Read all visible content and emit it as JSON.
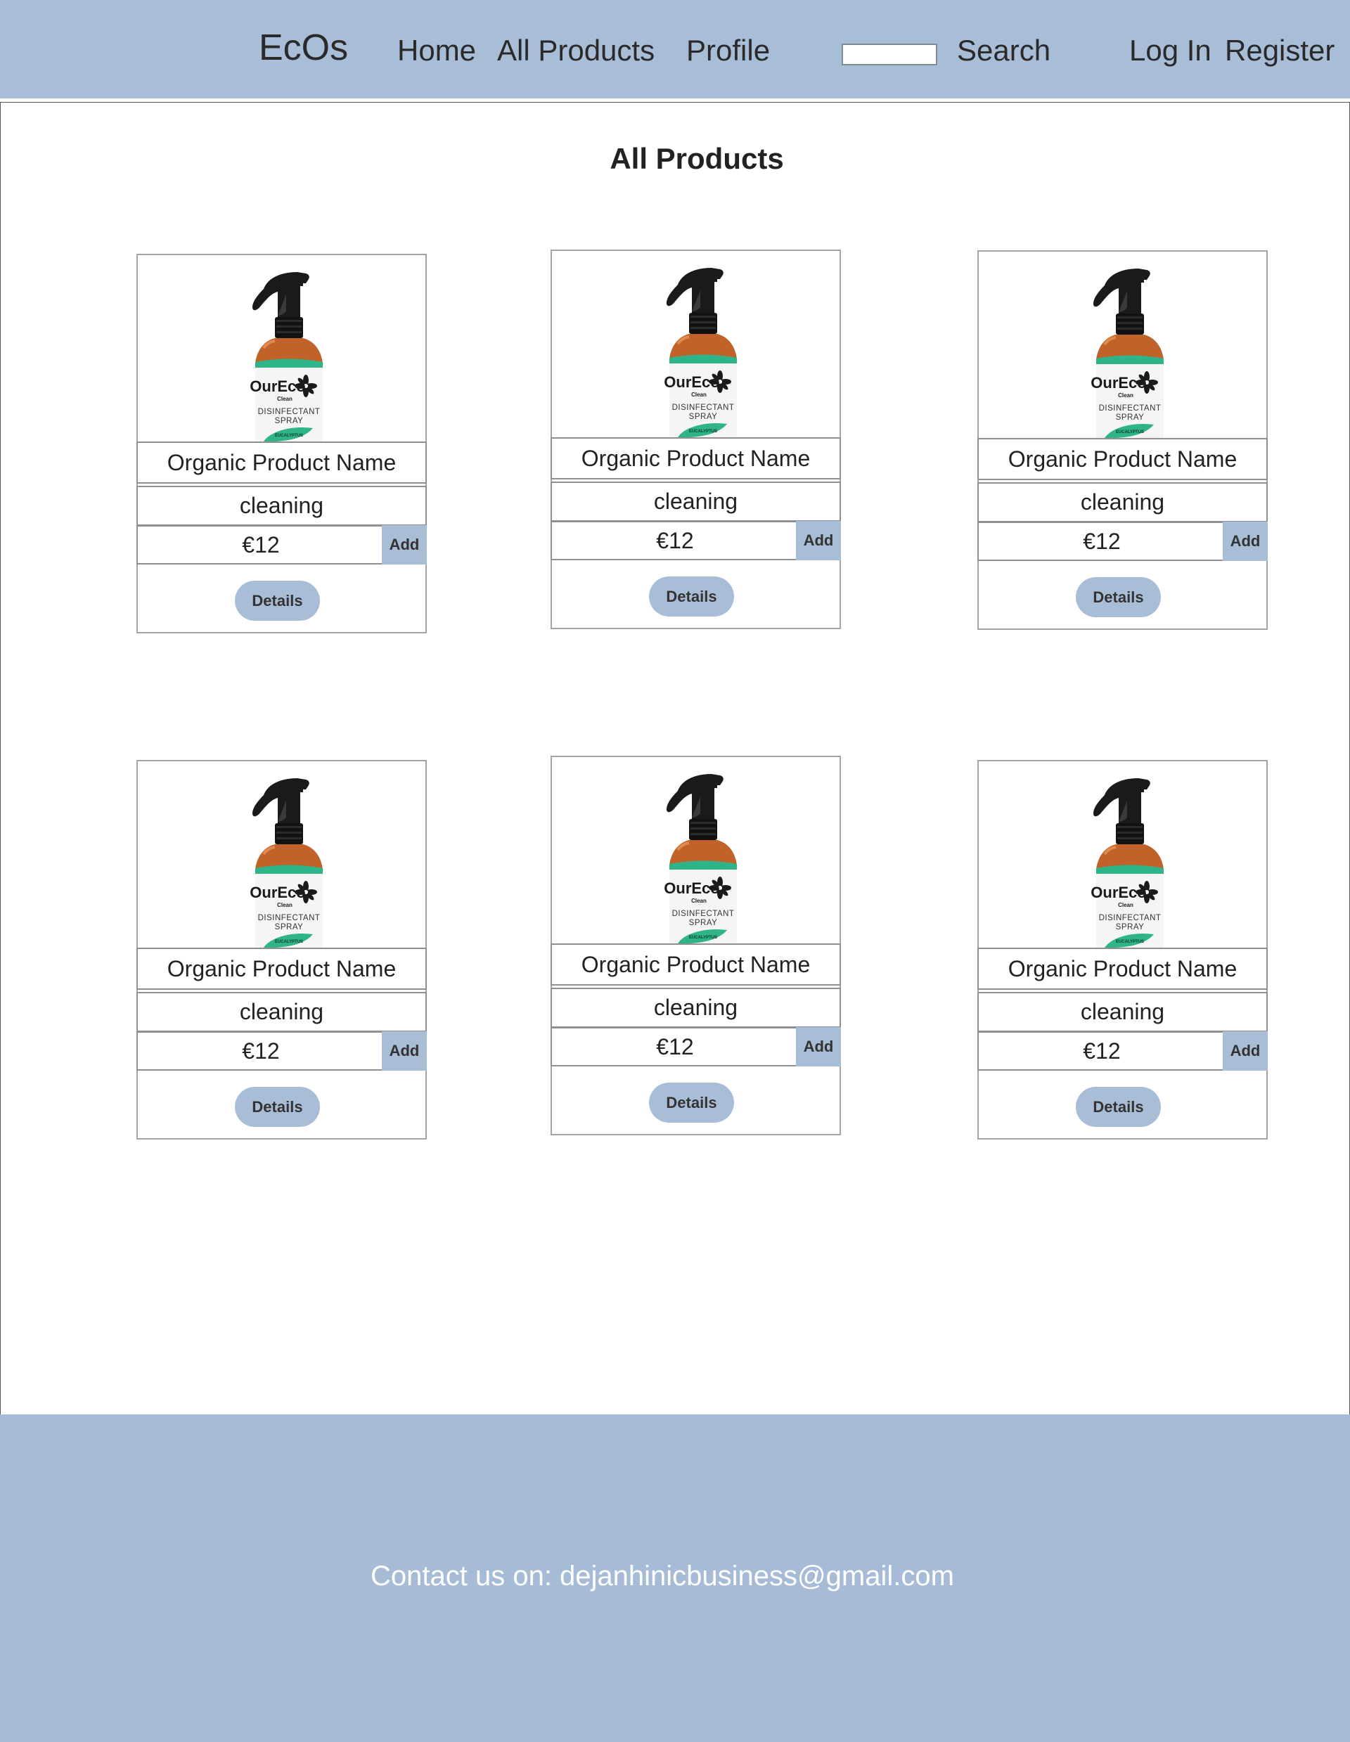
{
  "header": {
    "logo": "EcOs",
    "nav": {
      "home": "Home",
      "all_products": "All Products",
      "profile": "Profile"
    },
    "search": {
      "value": "",
      "placeholder": "",
      "button_label": "Search"
    },
    "auth": {
      "login": "Log In",
      "register": "Register"
    }
  },
  "main": {
    "title": "All Products",
    "products": [
      {
        "name": "Organic Product Name",
        "category": "cleaning",
        "price": "€12",
        "add_label": "Add",
        "details_label": "Details",
        "image": "disinfectant-spray-bottle"
      },
      {
        "name": "Organic Product Name",
        "category": "cleaning",
        "price": "€12",
        "add_label": "Add",
        "details_label": "Details",
        "image": "disinfectant-spray-bottle"
      },
      {
        "name": "Organic Product Name",
        "category": "cleaning",
        "price": "€12",
        "add_label": "Add",
        "details_label": "Details",
        "image": "disinfectant-spray-bottle"
      },
      {
        "name": "Organic Product Name",
        "category": "cleaning",
        "price": "€12",
        "add_label": "Add",
        "details_label": "Details",
        "image": "disinfectant-spray-bottle"
      },
      {
        "name": "Organic Product Name",
        "category": "cleaning",
        "price": "€12",
        "add_label": "Add",
        "details_label": "Details",
        "image": "disinfectant-spray-bottle"
      },
      {
        "name": "Organic Product Name",
        "category": "cleaning",
        "price": "€12",
        "add_label": "Add",
        "details_label": "Details",
        "image": "disinfectant-spray-bottle"
      }
    ],
    "bottle_label": {
      "brand": "OurEco",
      "sub": "Clean",
      "line1": "DISINFECTANT",
      "line2": "SPRAY",
      "scent1": "EUCALYPTUS",
      "scent2": "TEA TREE"
    }
  },
  "footer": {
    "contact": "Contact us on: dejanhinicbusiness@gmail.com"
  },
  "colors": {
    "accent": "#a8bdd6",
    "bottle": "#c0622a",
    "leaf": "#2fb48a"
  }
}
